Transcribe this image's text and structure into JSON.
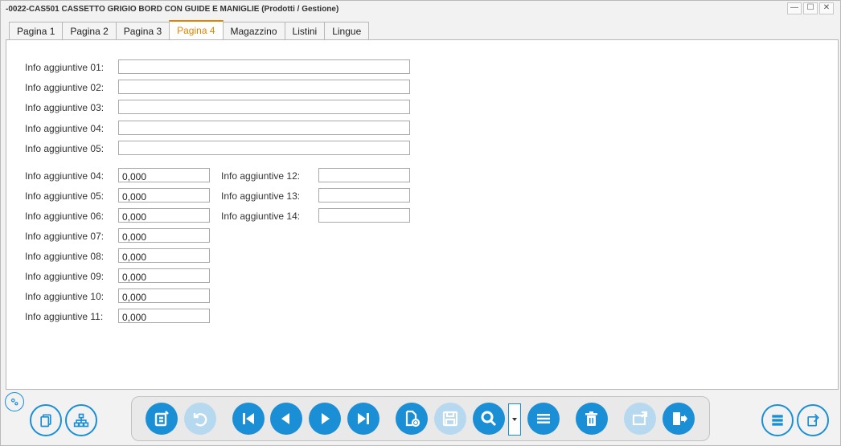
{
  "window": {
    "title": "-0022-CAS501 CASSETTO GRIGIO BORD CON GUIDE E MANIGLIE (Prodotti / Gestione)",
    "minimize": "—",
    "maximize": "☐",
    "close": "✕"
  },
  "tabs": [
    {
      "label": "Pagina 1"
    },
    {
      "label": "Pagina 2"
    },
    {
      "label": "Pagina 3"
    },
    {
      "label": "Pagina 4"
    },
    {
      "label": "Magazzino"
    },
    {
      "label": "Listini"
    },
    {
      "label": "Lingue"
    }
  ],
  "active_tab": "Pagina 4",
  "text_fields": [
    {
      "label": "Info aggiuntive 01:",
      "value": ""
    },
    {
      "label": "Info aggiuntive 02:",
      "value": ""
    },
    {
      "label": "Info aggiuntive 03:",
      "value": ""
    },
    {
      "label": "Info aggiuntive 04:",
      "value": ""
    },
    {
      "label": "Info aggiuntive 05:",
      "value": ""
    }
  ],
  "numeric_fields": [
    {
      "label": "Info aggiuntive 04:",
      "value": "0,000"
    },
    {
      "label": "Info aggiuntive 05:",
      "value": "0,000"
    },
    {
      "label": "Info aggiuntive 06:",
      "value": "0,000"
    },
    {
      "label": "Info aggiuntive 07:",
      "value": "0,000"
    },
    {
      "label": "Info aggiuntive 08:",
      "value": "0,000"
    },
    {
      "label": "Info aggiuntive 09:",
      "value": "0,000"
    },
    {
      "label": "Info aggiuntive 10:",
      "value": "0,000"
    },
    {
      "label": "Info aggiuntive 11:",
      "value": "0,000"
    }
  ],
  "right_fields": [
    {
      "label": "Info aggiuntive 12:",
      "value": ""
    },
    {
      "label": "Info aggiuntive 13:",
      "value": ""
    },
    {
      "label": "Info aggiuntive 14:",
      "value": ""
    }
  ],
  "colors": {
    "accent": "#1a8fd6",
    "accent_disabled": "#b7d9ef",
    "active_tab": "#e38400"
  },
  "toolbar_icons": [
    "edit-icon",
    "undo-icon",
    "first-record-icon",
    "previous-record-icon",
    "next-record-icon",
    "last-record-icon",
    "new-document-icon",
    "save-icon",
    "search-icon",
    "list-icon",
    "delete-icon",
    "export-icon",
    "exit-icon"
  ],
  "side_icons": [
    "settings-icon",
    "copy-icon",
    "hierarchy-icon",
    "database-icon",
    "new-icon"
  ]
}
